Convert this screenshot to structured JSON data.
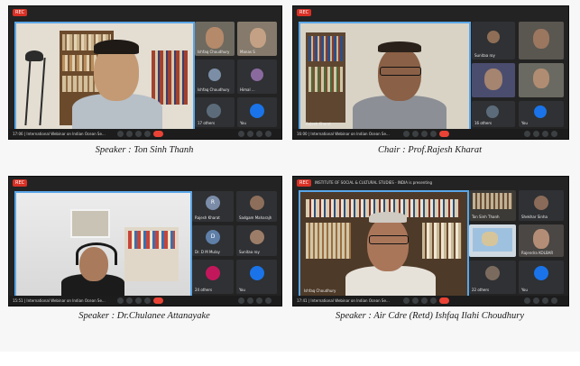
{
  "panels": [
    {
      "recording_badge": "REC",
      "time": "17:06",
      "meeting_title": "International Webinar on Indian Ocean Se...",
      "main_speaker_name": "",
      "participants": [
        {
          "name": "Ishfaq Choudhury"
        },
        {
          "name": "Manas S"
        },
        {
          "name": "Ishfaq Choudhury"
        },
        {
          "name": "Himal ..."
        },
        {
          "name": "17 others"
        },
        {
          "name": "You"
        }
      ],
      "caption": "Speaker : Ton Sinh Thanh"
    },
    {
      "recording_badge": "REC",
      "time": "16:00",
      "meeting_title": "International Webinar on Indian Ocean Se...",
      "main_speaker_name": "Rajesh Kharat",
      "participants": [
        {
          "name": "Sunitaa roy"
        },
        {
          "name": ""
        },
        {
          "name": ""
        },
        {
          "name": ""
        },
        {
          "name": "16 others"
        },
        {
          "name": "You"
        }
      ],
      "caption": "Chair : Prof.Rajesh Kharat"
    },
    {
      "recording_badge": "REC",
      "time": "15:51",
      "meeting_title": "International Webinar on Indian Ocean Se...",
      "main_speaker_name": "",
      "participants": [
        {
          "name": "Rajesh Kharat",
          "initial": "R"
        },
        {
          "name": "Sadgam Maharajh"
        },
        {
          "name": "Dr. D M Mulay",
          "initial": "D"
        },
        {
          "name": "Sunitaa roy"
        },
        {
          "name": "24 others"
        },
        {
          "name": "You"
        }
      ],
      "caption": "Speaker : Dr.Chulanee Attanayake"
    },
    {
      "recording_badge": "REC",
      "time": "17:41",
      "meeting_title": "International Webinar on Indian Ocean Se...",
      "presenting_banner": "INSTITUTE OF SOCIAL & CULTURAL STUDIES - INDIA is presenting",
      "main_speaker_name": "Ishfaq Choudhury",
      "participants": [
        {
          "name": "Ton Sinh Thanh"
        },
        {
          "name": "Shekhar Sinha"
        },
        {
          "name": ""
        },
        {
          "name": "Rajendra KOLBAR"
        },
        {
          "name": "22 others"
        },
        {
          "name": "You"
        }
      ],
      "caption": "Speaker : Air Cdre (Retd) Ishfaq Ilahi Choudhury"
    }
  ],
  "colors": {
    "caption": "#1a1a1a",
    "tile_border": "#5aa6e8",
    "end_call": "#ea4335",
    "rec": "#d93025"
  },
  "icons": [
    "microphone-icon",
    "camera-icon",
    "captions-icon",
    "present-icon",
    "end-call-icon",
    "info-icon",
    "people-icon",
    "chat-icon",
    "activities-icon"
  ]
}
